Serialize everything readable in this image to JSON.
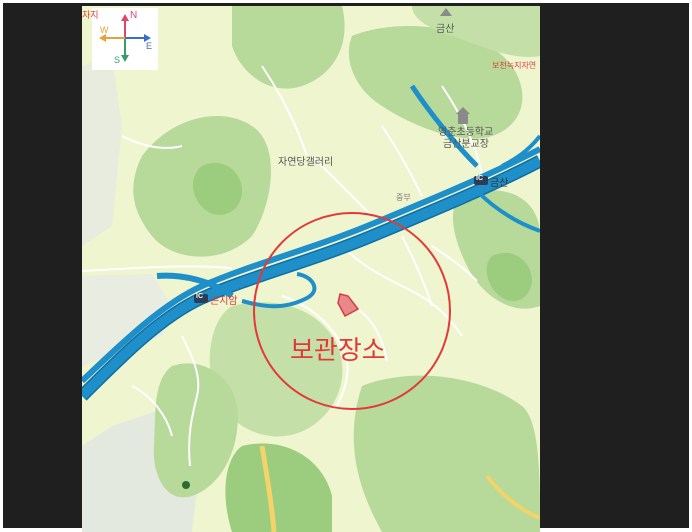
{
  "map": {
    "marker_label": "보관장소",
    "labels": {
      "mountain": "금산",
      "school_line1": "영춘초등학교",
      "school_line2": "금산분교장",
      "gallery": "자연당갤러리",
      "ic_geumsan": "금산",
      "ic_gonjiam": "곤지암",
      "ic_badge": "IC",
      "top_left": "자지",
      "top_right": "보천녹지자연",
      "road_mid": "중부"
    },
    "compass": {
      "north": "N",
      "east": "E",
      "south": "S",
      "west": "W"
    },
    "colors": {
      "land": "#eef5cf",
      "forest": "#b7d99a",
      "forest_dark": "#9ccc7e",
      "highway": "#1e8fc8",
      "highway_edge": "#0f6ea3",
      "road": "#ffffff",
      "circle": "#e23a3a",
      "marker_fill": "#e9888a",
      "text": "#555555",
      "accent_text": "#e23a3a"
    }
  }
}
